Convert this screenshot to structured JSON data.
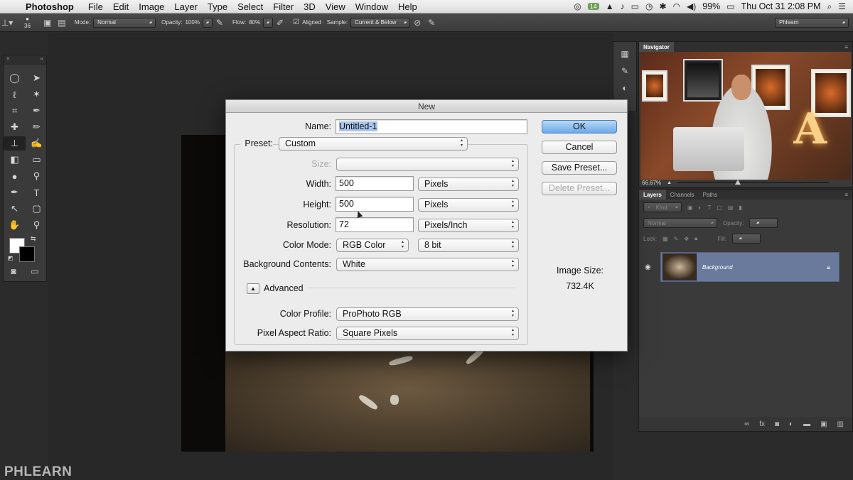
{
  "menubar": {
    "app_name": "Photoshop",
    "items": [
      "File",
      "Edit",
      "Image",
      "Layer",
      "Type",
      "Select",
      "Filter",
      "3D",
      "View",
      "Window",
      "Help"
    ],
    "badge": "14",
    "battery": "99%",
    "clock": "Thu Oct 31  2:08 PM"
  },
  "options": {
    "brush_size": "36",
    "mode_label": "Mode:",
    "mode_value": "Normal",
    "opacity_label": "Opacity:",
    "opacity_value": "100%",
    "flow_label": "Flow:",
    "flow_value": "80%",
    "aligned_label": "Aligned",
    "sample_label": "Sample:",
    "sample_value": "Current & Below",
    "workspace": "Phlearn"
  },
  "navigator": {
    "tab": "Navigator",
    "zoom": "66.67%"
  },
  "layers": {
    "tabs": [
      "Layers",
      "Channels",
      "Paths"
    ],
    "kind": "Kind",
    "blend": "Normal",
    "opacity_label": "Opacity:",
    "lock_label": "Lock:",
    "fill_label": "Fill:",
    "layer_name": "Background"
  },
  "watermark": "PHLEARN",
  "dialog": {
    "title": "New",
    "name_label": "Name:",
    "name_value": "Untitled-1",
    "preset_label": "Preset:",
    "preset_value": "Custom",
    "size_label": "Size:",
    "size_value": "",
    "width_label": "Width:",
    "width_value": "500",
    "width_unit": "Pixels",
    "height_label": "Height:",
    "height_value": "500",
    "height_unit": "Pixels",
    "resolution_label": "Resolution:",
    "resolution_value": "72",
    "resolution_unit": "Pixels/Inch",
    "colormode_label": "Color Mode:",
    "colormode_value": "RGB Color",
    "bitdepth_value": "8 bit",
    "bgcontents_label": "Background Contents:",
    "bgcontents_value": "White",
    "advanced_label": "Advanced",
    "colorprofile_label": "Color Profile:",
    "colorprofile_value": "ProPhoto RGB",
    "aspect_label": "Pixel Aspect Ratio:",
    "aspect_value": "Square Pixels",
    "ok": "OK",
    "cancel": "Cancel",
    "save_preset": "Save Preset...",
    "delete_preset": "Delete Preset...",
    "image_size_label": "Image Size:",
    "image_size_value": "732.4K"
  }
}
